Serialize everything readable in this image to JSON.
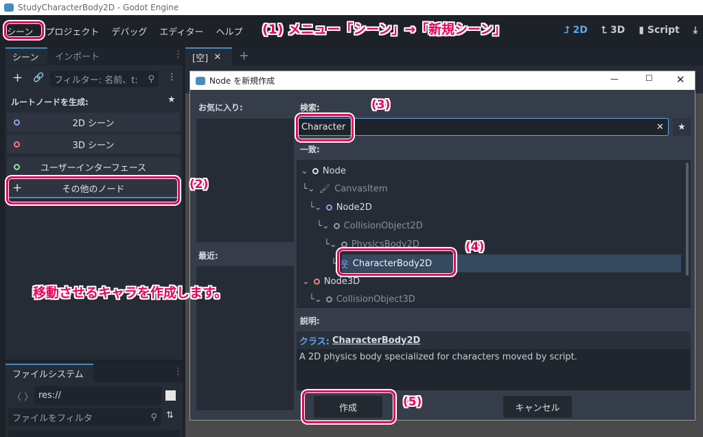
{
  "window": {
    "title": "StudyCharacterBody2D - Godot Engine"
  },
  "menu": [
    "シーン",
    "プロジェクト",
    "デバッグ",
    "エディター",
    "ヘルプ"
  ],
  "modes": {
    "d2": "2D",
    "d3": "3D",
    "script": "Script"
  },
  "annotations": {
    "a1": "(1) メニュー「シーン」→「新規シーン」",
    "a2": "(2)",
    "a3": "(3)",
    "a4": "(4)",
    "a5": "(5)",
    "note": "移動させるキャラを作成します。"
  },
  "scene_dock": {
    "tabs": [
      "シーン",
      "インポート"
    ],
    "filter_placeholder": "フィルター: 名前、t:",
    "root_label": "ルートノードを生成:",
    "buttons": [
      "2D シーン",
      "3D シーン",
      "ユーザーインターフェース",
      "その他のノード"
    ]
  },
  "filesystem": {
    "tab": "ファイルシステム",
    "path": "res://",
    "filter_placeholder": "ファイルをフィルタ"
  },
  "editor_tabs": {
    "tab": "[空]"
  },
  "dialog": {
    "title": "Node を新規作成",
    "favorites": "お気に入り:",
    "recent": "最近:",
    "search_label": "検索:",
    "search_value": "Character",
    "matches": "一致:",
    "tree": [
      "Node",
      "CanvasItem",
      "Node2D",
      "CollisionObject2D",
      "PhysicsBody2D",
      "CharacterBody2D",
      "Node3D",
      "CollisionObject3D"
    ],
    "description_label": "説明:",
    "class_prefix": "クラス:",
    "class_name": "CharacterBody2D",
    "description": "A 2D physics body specialized for characters moved by script.",
    "create": "作成",
    "cancel": "キャンセル"
  },
  "colors": {
    "accent": "#478cbf",
    "annotation": "#e8005a",
    "selected_row": "#35495f"
  }
}
